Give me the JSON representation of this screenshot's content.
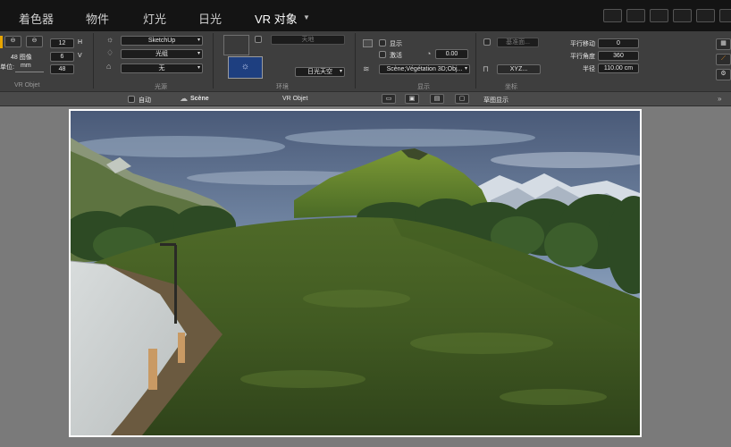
{
  "tabs": [
    {
      "label": "着色器"
    },
    {
      "label": "物件"
    },
    {
      "label": "灯光"
    },
    {
      "label": "日光"
    },
    {
      "label": "VR 对象"
    }
  ],
  "vr": {
    "images_label": "48 图像",
    "unit_label": "单位:",
    "unit_value": "mm",
    "h_value": "12",
    "h_label": "H",
    "v_value": "6",
    "v_label": "V",
    "total_value": "48",
    "section": "VR Objet"
  },
  "light": {
    "renderer": "SketchUp",
    "group": "光组",
    "mode": "无",
    "section": "光源"
  },
  "env": {
    "dim_field": "天地",
    "sky": "日光天空",
    "section": "环境"
  },
  "display": {
    "show_label": "显示",
    "activate_label": "激活",
    "value": "0.00",
    "scene_path": "Scène;Végétation 3D;Obj...",
    "section": "显示"
  },
  "coord": {
    "dim_field": "基准面...",
    "xyz_button": "XYZ...",
    "section": "坐标"
  },
  "transform": {
    "pan_label": "平行移动",
    "pan_value": "0",
    "angle_label": "平行角度",
    "angle_value": "360",
    "radius_label": "半径",
    "radius_value": "110.00 cm"
  },
  "subbar": {
    "auto_label": "自动",
    "scene_label": "Scène",
    "vr_label": "VR Objet",
    "sketch_label": "草图显示"
  },
  "colors": {
    "topbar": "#141414",
    "panel": "#3e3e3e",
    "canvas_bg": "#7a7a7a"
  }
}
